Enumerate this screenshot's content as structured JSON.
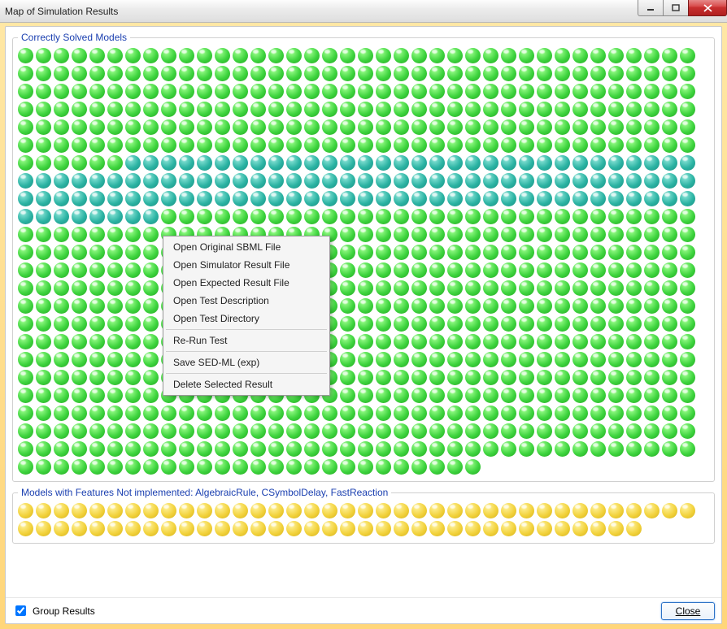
{
  "window": {
    "title": "Map of Simulation Results"
  },
  "groups": {
    "solved": {
      "legend": "Correctly Solved Models",
      "dot_rows": [
        "gggggggggggggggggggggggggggggggggggggg",
        "gggggggggggggggggggggggggggggggggggggg",
        "gggggggggggggggggggggggggggggggggggggg",
        "gggggggggggggggggggggggggggggggggggggg",
        "gggggggggggggggggggggggggggggggggggggg",
        "gggggggggggggggggggggggggggggggggggggg",
        "ggggggtttttttttttttttttttttttttttttttt",
        "tttttttttttttttttttttttttttttttttttttt",
        "tttttttttttttttttttttttttttttttttttttt",
        "ttttttttgggggggggggggggggggggggggggggg",
        "gggggggggggggggggggggggggggggggggggggg",
        "gggggggggggggggggggggggggggggggggggggg",
        "gggggggggggggggggggggggggggggggggggggg",
        "gggggggggggggggggggggggggggggggggggggg",
        "gggggggggggggggggggggggggggggggggggggg",
        "gggggggggggggggggggggggggggggggggggggg",
        "gggggggggggggggggggggggggggggggggggggg",
        "gggggggggggggggggggggggggggggggggggggg",
        "gggggggggggggggggggggggggggggggggggggg",
        "gggggggggggggggggggggggggggggggggggggg",
        "gggggggggggggggggggggggggggggggggggggg",
        "gggggggggggggggggggggggggggggggggggggg",
        "gggggggggggggggggggggggggggggggggggggg",
        "gggggggggggggggggggggggggg"
      ]
    },
    "not_impl": {
      "legend": "Models with Features Not implemented: AlgebraicRule, CSymbolDelay, FastReaction",
      "dot_rows": [
        "yyyyyyyyyyyyyyyyyyyyyyyyyyyyyyyyyyyyyy",
        "yyyyyyyyyyyyyyyyyyyyyyyyyyyyyyyyyyy"
      ]
    }
  },
  "context_menu": {
    "items": [
      "Open Original SBML File",
      "Open Simulator Result File",
      "Open Expected Result File",
      "Open Test Description",
      "Open Test Directory",
      "-",
      "Re-Run Test",
      "-",
      "Save SED-ML (exp)",
      "-",
      "Delete Selected Result"
    ]
  },
  "footer": {
    "group_results_label": "Group Results",
    "group_results_checked": true,
    "close_label": "Close"
  }
}
